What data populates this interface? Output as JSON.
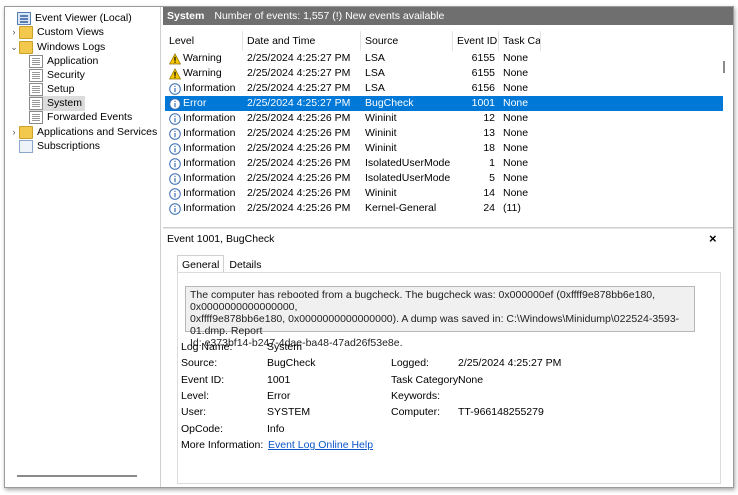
{
  "tree": {
    "items": [
      {
        "label": "Event Viewer (Local)",
        "chev": "",
        "icon": "event-viewer-icon"
      },
      {
        "label": "Custom Views",
        "chev": "›",
        "icon": "folder-icon"
      },
      {
        "label": "Windows Logs",
        "chev": "⌄",
        "icon": "folder-icon"
      },
      {
        "label": "Application",
        "chev": "",
        "icon": "log-icon"
      },
      {
        "label": "Security",
        "chev": "",
        "icon": "log-icon"
      },
      {
        "label": "Setup",
        "chev": "",
        "icon": "log-icon"
      },
      {
        "label": "System",
        "chev": "",
        "icon": "log-icon",
        "selected": true
      },
      {
        "label": "Forwarded Events",
        "chev": "",
        "icon": "log-icon"
      },
      {
        "label": "Applications and Services Lo",
        "chev": "›",
        "icon": "folder-icon"
      },
      {
        "label": "Subscriptions",
        "chev": "",
        "icon": "subscriptions-icon"
      }
    ]
  },
  "header": {
    "log_name": "System",
    "summary": "Number of events: 1,557 (!) New events available"
  },
  "table": {
    "columns": [
      "Level",
      "Date and Time",
      "Source",
      "Event ID",
      "Task Ca..."
    ],
    "rows": [
      {
        "level": "Warning",
        "date": "2/25/2024 4:25:27 PM",
        "source": "LSA",
        "id": "6155",
        "task": "None",
        "icon": "warning-icon"
      },
      {
        "level": "Warning",
        "date": "2/25/2024 4:25:27 PM",
        "source": "LSA",
        "id": "6155",
        "task": "None",
        "icon": "warning-icon"
      },
      {
        "level": "Information",
        "date": "2/25/2024 4:25:27 PM",
        "source": "LSA",
        "id": "6156",
        "task": "None",
        "icon": "info-icon"
      },
      {
        "level": "Error",
        "date": "2/25/2024 4:25:27 PM",
        "source": "BugCheck",
        "id": "1001",
        "task": "None",
        "icon": "info-icon",
        "selected": true
      },
      {
        "level": "Information",
        "date": "2/25/2024 4:25:26 PM",
        "source": "Wininit",
        "id": "12",
        "task": "None",
        "icon": "info-icon"
      },
      {
        "level": "Information",
        "date": "2/25/2024 4:25:26 PM",
        "source": "Wininit",
        "id": "13",
        "task": "None",
        "icon": "info-icon"
      },
      {
        "level": "Information",
        "date": "2/25/2024 4:25:26 PM",
        "source": "Wininit",
        "id": "18",
        "task": "None",
        "icon": "info-icon"
      },
      {
        "level": "Information",
        "date": "2/25/2024 4:25:26 PM",
        "source": "IsolatedUserMode",
        "id": "1",
        "task": "None",
        "icon": "info-icon"
      },
      {
        "level": "Information",
        "date": "2/25/2024 4:25:26 PM",
        "source": "IsolatedUserMode",
        "id": "5",
        "task": "None",
        "icon": "info-icon"
      },
      {
        "level": "Information",
        "date": "2/25/2024 4:25:26 PM",
        "source": "Wininit",
        "id": "14",
        "task": "None",
        "icon": "info-icon"
      },
      {
        "level": "Information",
        "date": "2/25/2024 4:25:26 PM",
        "source": "Kernel-General",
        "id": "24",
        "task": "(11)",
        "icon": "info-icon"
      }
    ]
  },
  "detail": {
    "title": "Event 1001, BugCheck",
    "close": "×",
    "tabs": [
      "General",
      "Details"
    ],
    "description_lines": [
      "The computer has rebooted from a bugcheck.  The bugcheck was: 0x000000ef (0xffff9e878bb6e180, 0x0000000000000000,",
      "0xffff9e878bb6e180, 0x0000000000000000). A dump was saved in: C:\\Windows\\Minidump\\022524-3593-01.dmp. Report",
      "Id: e373bf14-b247-4dae-ba48-47ad26f53e8e."
    ],
    "fields": {
      "log_name_label": "Log Name:",
      "log_name": "System",
      "source_label": "Source:",
      "source": "BugCheck",
      "logged_label": "Logged:",
      "logged": "2/25/2024 4:25:27 PM",
      "event_id_label": "Event ID:",
      "event_id": "1001",
      "task_category_label": "Task Category:",
      "task_category": "None",
      "level_label": "Level:",
      "level": "Error",
      "keywords_label": "Keywords:",
      "keywords": "",
      "user_label": "User:",
      "user": "SYSTEM",
      "computer_label": "Computer:",
      "computer": "TT-966148255279",
      "opcode_label": "OpCode:",
      "opcode": "Info",
      "more_info_label": "More Information:",
      "more_info_link": "Event Log Online Help"
    }
  },
  "colors": {
    "selected_row": "#0078d7",
    "header_bar": "#6f6f6f",
    "link": "#0a55c9"
  }
}
